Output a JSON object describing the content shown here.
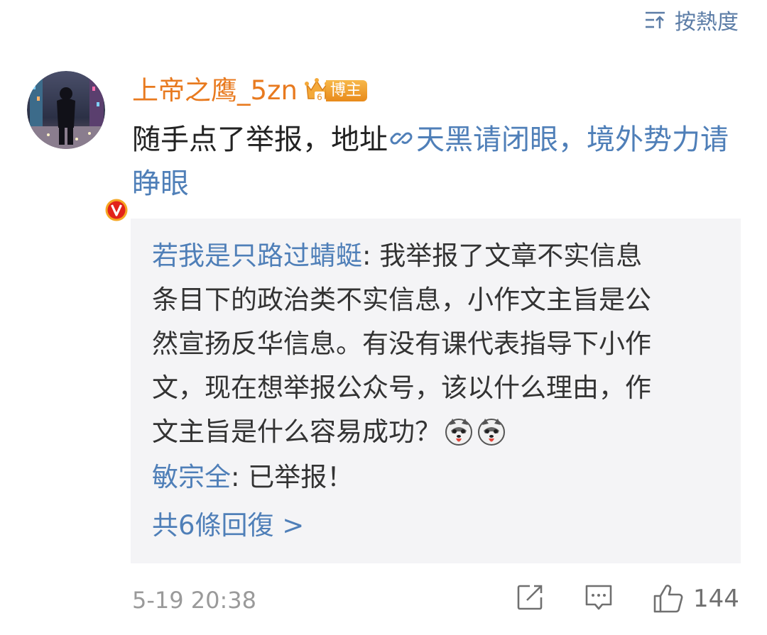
{
  "sort": {
    "label": "按熱度",
    "icon": "sort-icon"
  },
  "comment": {
    "username": "上帝之鹰_5zn",
    "badge_label": "博主",
    "verified_icon": "verified-v-icon",
    "text_prefix": "随手点了举报，地址",
    "link_text": "天黑请闭眼，境外势力请睁眼",
    "timestamp": "5-19 20:38",
    "likes": "144"
  },
  "replies": [
    {
      "author": "若我是只路过蜻蜓",
      "separator": ": ",
      "line1": "我举报了文章不实信息",
      "line2": "条目下的政治类不实信息，小作文主旨是公",
      "line3": "然宣扬反华信息。有没有课代表指导下小作",
      "line4": "文，现在想举报公众号，该以什么理由，作",
      "line5": "文主旨是什么容易成功？",
      "emoji": "husky-emoji"
    },
    {
      "author": "敏宗全",
      "separator": ": ",
      "text": "已举报！"
    }
  ],
  "reply_count_label": "共6條回復 >",
  "colors": {
    "username": "#e87a1f",
    "link": "#4f7fb8",
    "reply_bg": "#f4f4f6",
    "meta": "#9a9a9a"
  }
}
